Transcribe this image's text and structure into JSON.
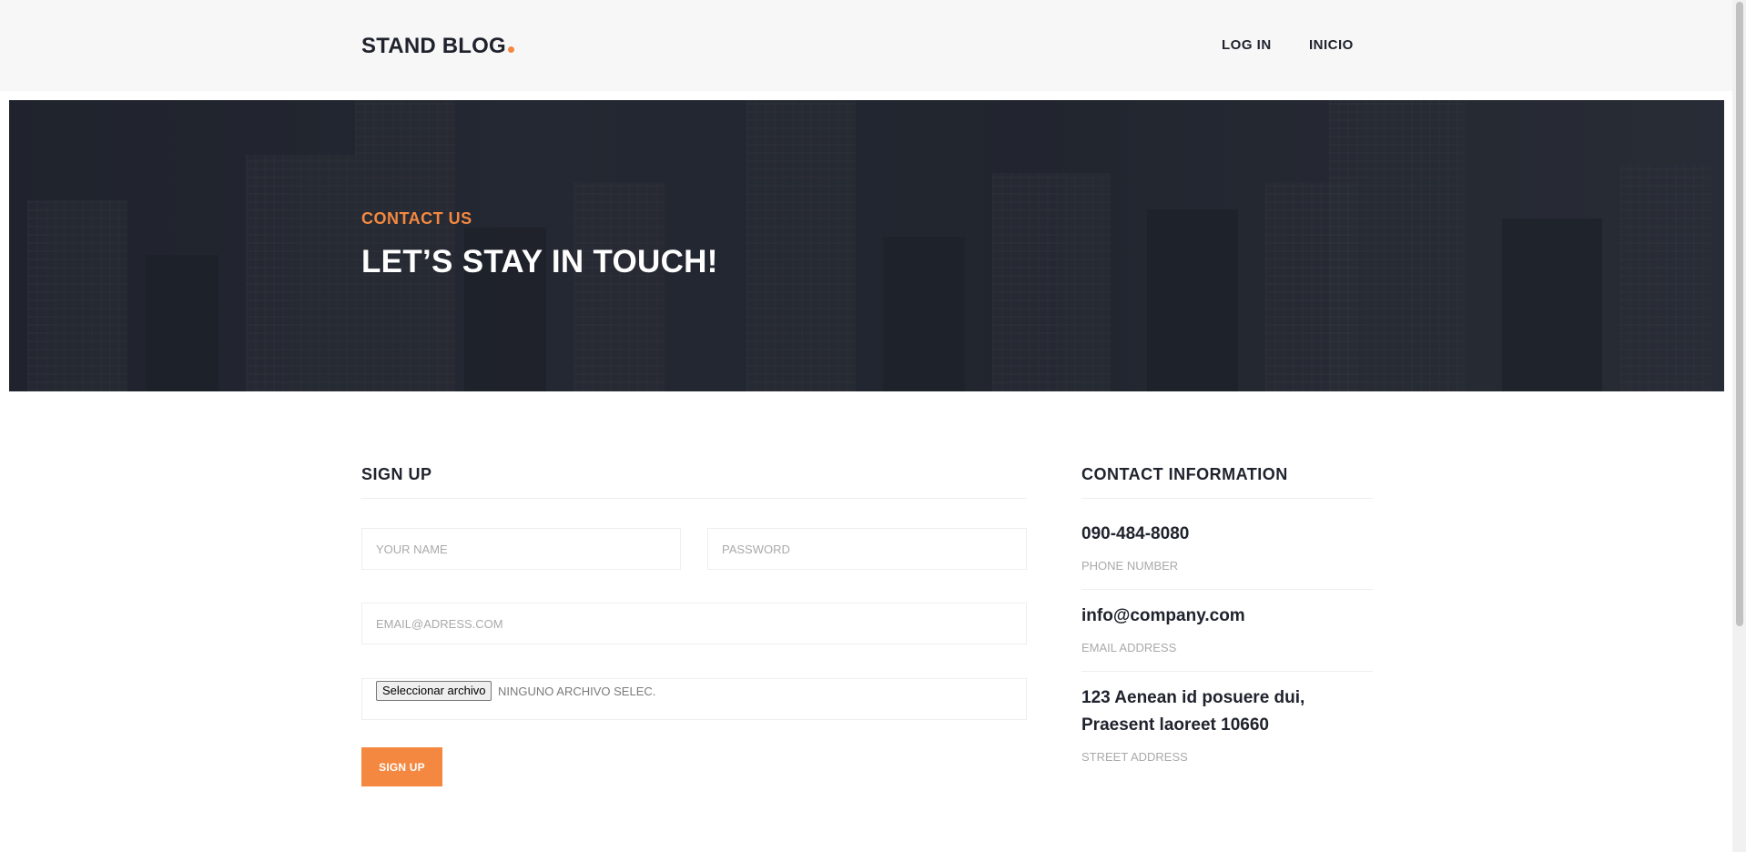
{
  "header": {
    "logo": "STAND BLOG",
    "nav": [
      {
        "label": "LOG IN"
      },
      {
        "label": "INICIO"
      }
    ]
  },
  "hero": {
    "subtitle": "CONTACT US",
    "title": "LET’S STAY IN TOUCH!"
  },
  "signup": {
    "title": "SIGN UP",
    "name_placeholder": "YOUR NAME",
    "password_placeholder": "PASSWORD",
    "email_placeholder": "EMAIL@ADRESS.COM",
    "file_button": "Seleccionar archivo",
    "file_status": "NINGUNO ARCHIVO SELEC.",
    "submit": "SIGN UP"
  },
  "contact": {
    "title": "CONTACT INFORMATION",
    "phone": {
      "value": "090-484-8080",
      "label": "PHONE NUMBER"
    },
    "email": {
      "value": "info@company.com",
      "label": "EMAIL ADDRESS"
    },
    "address": {
      "line1": "123 Aenean id posuere dui,",
      "line2": "Praesent laoreet 10660",
      "label": "STREET ADDRESS"
    }
  },
  "colors": {
    "accent": "#f48840",
    "text": "#20232e",
    "muted": "#aaaaaa"
  }
}
